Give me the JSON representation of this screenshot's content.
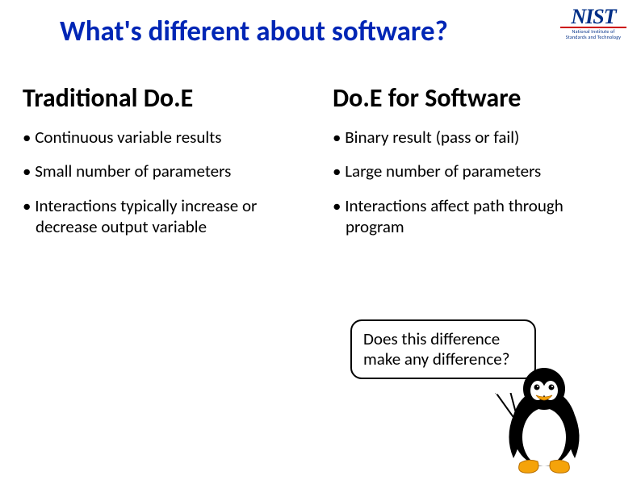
{
  "title": "What's different about software?",
  "logo": {
    "text": "NIST",
    "subtitle1": "National Institute of",
    "subtitle2": "Standards and Technology"
  },
  "columns": {
    "left": {
      "heading": "Traditional Do.E",
      "bullets": [
        "Continuous variable results",
        "Small number of parameters",
        "Interactions typically increase or decrease output variable"
      ]
    },
    "right": {
      "heading": "Do.E for Software",
      "bullets": [
        "Binary result (pass or fail)",
        "Large number of parameters",
        "Interactions  affect path through program"
      ]
    }
  },
  "speech_bubble": "Does this difference make any difference?"
}
